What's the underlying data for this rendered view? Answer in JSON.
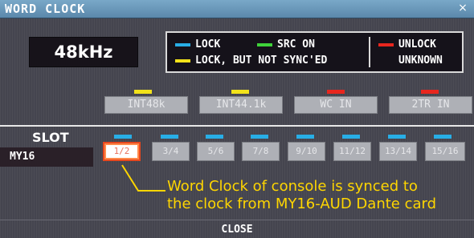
{
  "window": {
    "title": "WORD CLOCK",
    "close_glyph": "×"
  },
  "frequency": "48kHz",
  "legend": {
    "lock": "LOCK",
    "src_on": "SRC ON",
    "unlock": "UNLOCK",
    "lock_not_synced": "LOCK, BUT NOT SYNC'ED",
    "unknown": "UNKNOWN",
    "colors": {
      "lock": "#28aee6",
      "src_on": "#3fd23a",
      "unlock": "#e8261e",
      "lock_not_synced": "#f2e21a",
      "unknown": "#15121a"
    }
  },
  "sources": [
    {
      "label": "INT48k",
      "indicator": "#f2e21a"
    },
    {
      "label": "INT44.1k",
      "indicator": "#f2e21a"
    },
    {
      "label": "WC IN",
      "indicator": "#e8261e"
    },
    {
      "label": "2TR IN",
      "indicator": "#e8261e"
    }
  ],
  "slot": {
    "label": "SLOT",
    "name": "MY16",
    "channels": [
      {
        "label": "1/2",
        "selected": true
      },
      {
        "label": "3/4"
      },
      {
        "label": "5/6"
      },
      {
        "label": "7/8"
      },
      {
        "label": "9/10"
      },
      {
        "label": "11/12"
      },
      {
        "label": "13/14"
      },
      {
        "label": "15/16"
      }
    ]
  },
  "annotation": "Word Clock of console is synced to\nthe clock from MY16-AUD Dante card",
  "footer": {
    "close": "CLOSE"
  }
}
